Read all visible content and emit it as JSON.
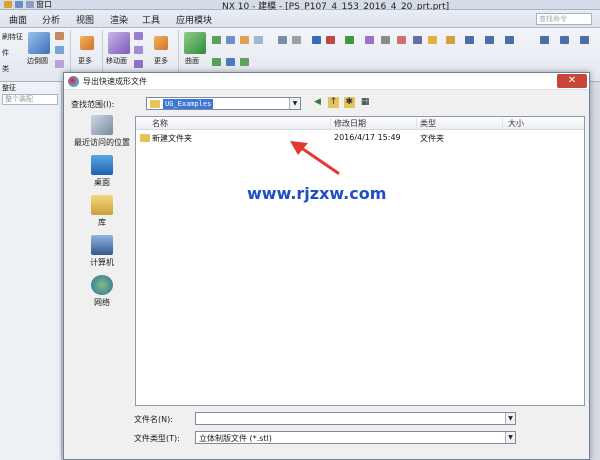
{
  "window": {
    "title": "NX 10 - 建模 - [PS_P107_4_153_2016_4_20_prt.prt]",
    "quick_access_label": "窗口"
  },
  "menubar": {
    "items": [
      "曲面",
      "分析",
      "视图",
      "渲染",
      "工具",
      "应用模块"
    ],
    "search_placeholder": "查找命令"
  },
  "ribbon": {
    "labels": [
      "刷特征",
      "件",
      "类",
      "边倒圆",
      "更多",
      "移动面",
      "更多",
      "曲面"
    ]
  },
  "left_panel": {
    "tab_label": "整征",
    "search_placeholder": "整个装配"
  },
  "dialog": {
    "title": "导出快速成形文件",
    "close_symbol": "✕",
    "look_in_label": "查找范围(I):",
    "look_in_value": "UG_Examples",
    "places": [
      {
        "label": "最近访问的位置",
        "icon": "recent-places-icon"
      },
      {
        "label": "桌面",
        "icon": "desktop-icon"
      },
      {
        "label": "库",
        "icon": "library-icon"
      },
      {
        "label": "计算机",
        "icon": "computer-icon"
      },
      {
        "label": "网络",
        "icon": "network-icon"
      }
    ],
    "columns": [
      "名称",
      "修改日期",
      "类型",
      "大小"
    ],
    "files": [
      {
        "name": "新建文件夹",
        "date": "2016/4/17 15:49",
        "type": "文件夹",
        "size": ""
      }
    ],
    "file_name_label": "文件名(N):",
    "file_name_value": "",
    "file_type_label": "文件类型(T):",
    "file_type_value": "立体制版文件 (*.stl)"
  },
  "watermark": "www.rjzxw.com",
  "colors": {
    "dialog_border": "#6f7f95",
    "selection": "#3a78d4",
    "annotation_arrow": "#e23a2e",
    "watermark": "#1f4fc6",
    "folder": "#e8c15a"
  }
}
